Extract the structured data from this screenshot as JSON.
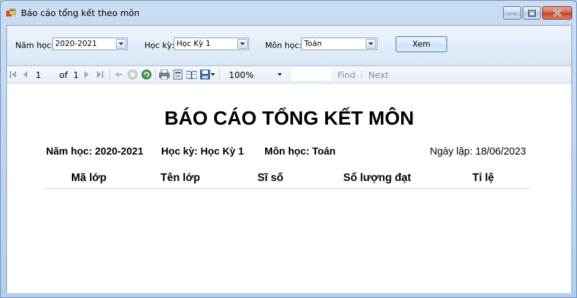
{
  "window": {
    "title": "Báo cáo tổng kết theo môn"
  },
  "filters": {
    "year_label": "Năm học:",
    "year_value": "2020-2021",
    "term_label": "Học kỳ:",
    "term_value": "Học Kỳ 1",
    "subject_label": "Môn học:",
    "subject_value": "Toán",
    "view_button": "Xem"
  },
  "toolbar": {
    "page_current": "1",
    "page_of": "of",
    "page_total": "1",
    "zoom": "100%",
    "find_label": "Find",
    "next_label": "Next"
  },
  "report": {
    "title": "BÁO CÁO TỔNG KẾT MÔN",
    "year": "Năm học: 2020-2021",
    "term": "Học kỳ: Học Kỳ 1",
    "subject": "Môn học: Toán",
    "date": "Ngày lập: 18/06/2023",
    "columns": [
      "Mã lớp",
      "Tên lớp",
      "Sĩ số",
      "Số lượng đạt",
      "Tỉ lệ"
    ]
  }
}
